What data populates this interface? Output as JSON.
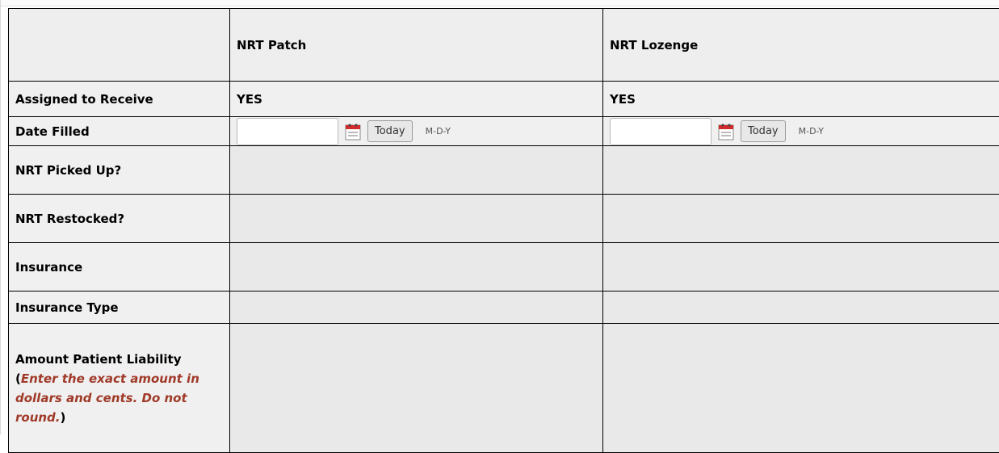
{
  "columns": [
    "",
    "NRT Patch",
    "NRT Lozenge"
  ],
  "rows": {
    "assigned": {
      "label": "Assigned to Receive",
      "patch": "YES",
      "lozenge": "YES"
    },
    "date_filled": {
      "label": "Date Filled",
      "today_label": "Today",
      "format_hint": "M-D-Y",
      "patch_value": "",
      "lozenge_value": ""
    },
    "picked_up": {
      "label": "NRT Picked Up?"
    },
    "restocked": {
      "label": "NRT Restocked?"
    },
    "insurance": {
      "label": "Insurance"
    },
    "insurance_type": {
      "label": "Insurance Type"
    },
    "amount": {
      "label": "Amount Patient Liability",
      "note_open": "(",
      "note": "Enter the exact amount in dollars and cents. Do not round.",
      "note_close": ")"
    }
  },
  "icons": {
    "calendar": "calendar-icon"
  },
  "colors": {
    "note": "#a03a28",
    "row_bg": "#f0f0f0"
  }
}
